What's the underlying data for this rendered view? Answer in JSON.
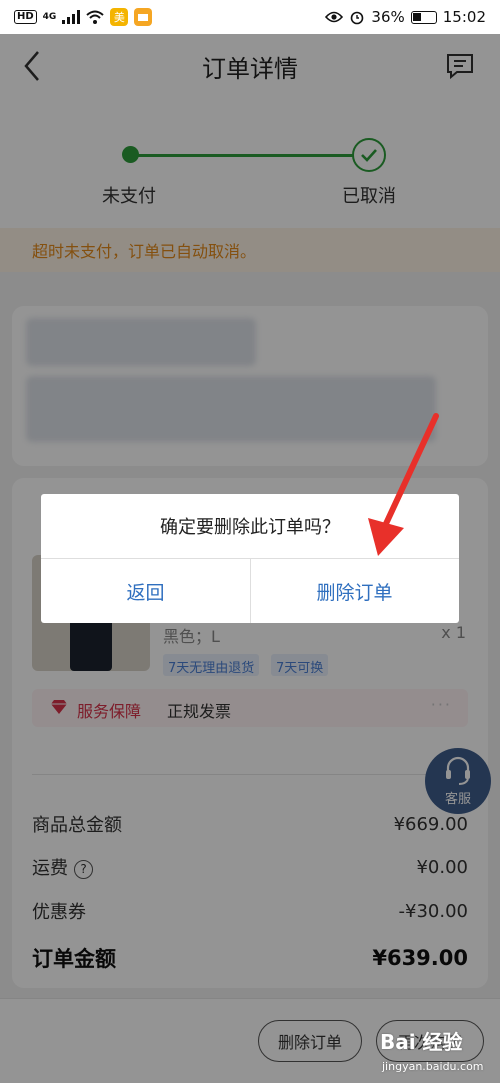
{
  "status_bar": {
    "network_badge": "HD",
    "network_type": "4G",
    "app_badge_1": "美",
    "battery": "36%",
    "time": "15:02"
  },
  "header": {
    "title": "订单详情",
    "icons": {
      "back": "chevron-left-icon",
      "message": "message-icon"
    }
  },
  "progress": {
    "steps": [
      {
        "label": "未支付",
        "done": true
      },
      {
        "label": "已取消",
        "done": true
      }
    ],
    "color": "#2e9e3b"
  },
  "notice": {
    "text": "超时未支付，订单已自动取消。",
    "color": "#e48a1a"
  },
  "product": {
    "spec": "黑色；L",
    "quantity": "x 1",
    "tags": [
      "7天无理由退货",
      "7天可换"
    ]
  },
  "guarantee": {
    "name": "服务保障",
    "value": "正规发票",
    "more": "···"
  },
  "summary": {
    "rows": [
      {
        "label": "商品总金额",
        "value": "¥669.00"
      },
      {
        "label": "运费",
        "value": "¥0.00",
        "help": "?"
      },
      {
        "label": "优惠券",
        "value": "-¥30.00"
      }
    ],
    "total": {
      "label": "订单金额",
      "value": "¥639.00"
    }
  },
  "bottom_bar": {
    "delete_label": "删除订单",
    "second_label": "再次购买"
  },
  "customer_service": {
    "label": "客服"
  },
  "dialog": {
    "message": "确定要删除此订单吗？",
    "cancel_label": "返回",
    "confirm_label": "删除订单",
    "button_color": "#2f6fbf"
  },
  "watermark": {
    "brand": "Bai 经验",
    "url": "jingyan.baidu.com"
  }
}
